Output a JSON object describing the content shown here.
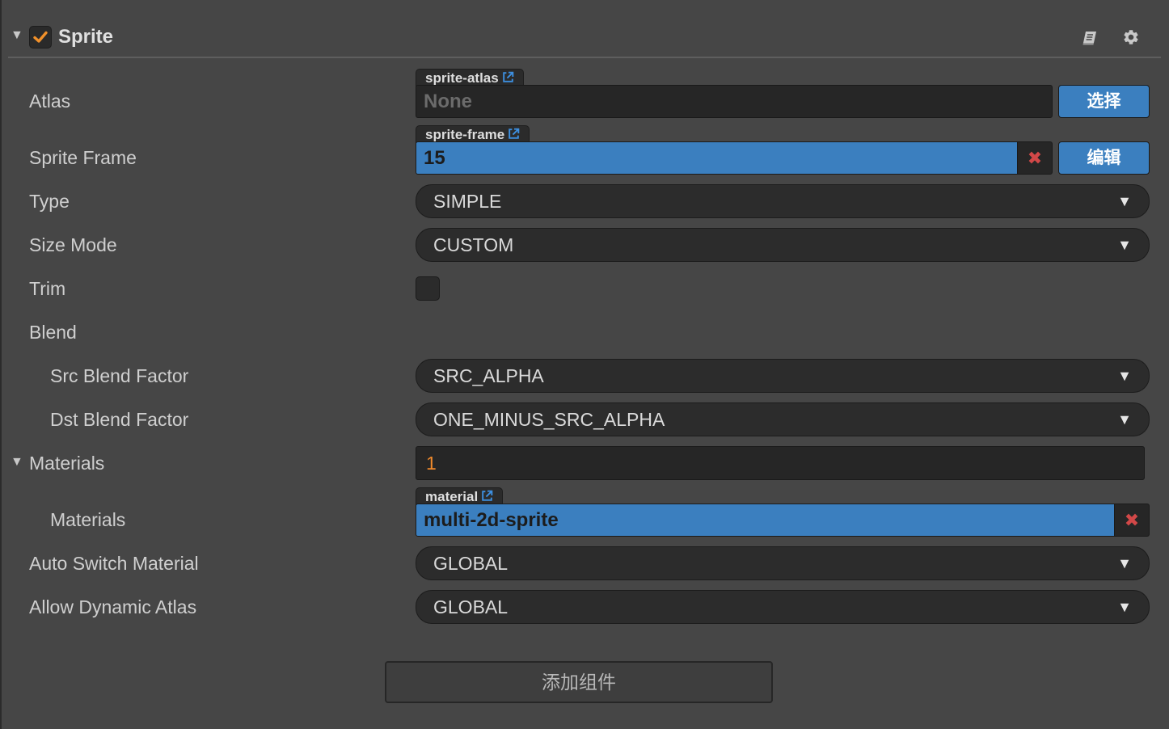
{
  "component": {
    "title": "Sprite",
    "enabled": true,
    "icons": [
      "book-icon",
      "gear-icon"
    ]
  },
  "properties": {
    "atlas": {
      "label": "Atlas",
      "asset_type": "sprite-atlas",
      "value": "None",
      "button_label": "选择"
    },
    "sprite_frame": {
      "label": "Sprite Frame",
      "asset_type": "sprite-frame",
      "value": "15",
      "button_label": "编辑"
    },
    "type": {
      "label": "Type",
      "value": "SIMPLE"
    },
    "size_mode": {
      "label": "Size Mode",
      "value": "CUSTOM"
    },
    "trim": {
      "label": "Trim",
      "checked": false
    },
    "blend": {
      "label": "Blend",
      "src": {
        "label": "Src Blend Factor",
        "value": "SRC_ALPHA"
      },
      "dst": {
        "label": "Dst Blend Factor",
        "value": "ONE_MINUS_SRC_ALPHA"
      }
    },
    "materials": {
      "label": "Materials",
      "count": "1",
      "item": {
        "label": "Materials",
        "asset_type": "material",
        "value": "multi-2d-sprite"
      }
    },
    "auto_switch_material": {
      "label": "Auto Switch Material",
      "value": "GLOBAL"
    },
    "allow_dynamic_atlas": {
      "label": "Allow Dynamic Atlas",
      "value": "GLOBAL"
    }
  },
  "add_component_label": "添加组件",
  "colors": {
    "panel_bg": "#464646",
    "field_dark": "#262626",
    "accent_blue": "#3b7fbf",
    "check_orange": "#f0902a",
    "number_orange": "#f08a2c",
    "remove_red": "#d24848"
  }
}
